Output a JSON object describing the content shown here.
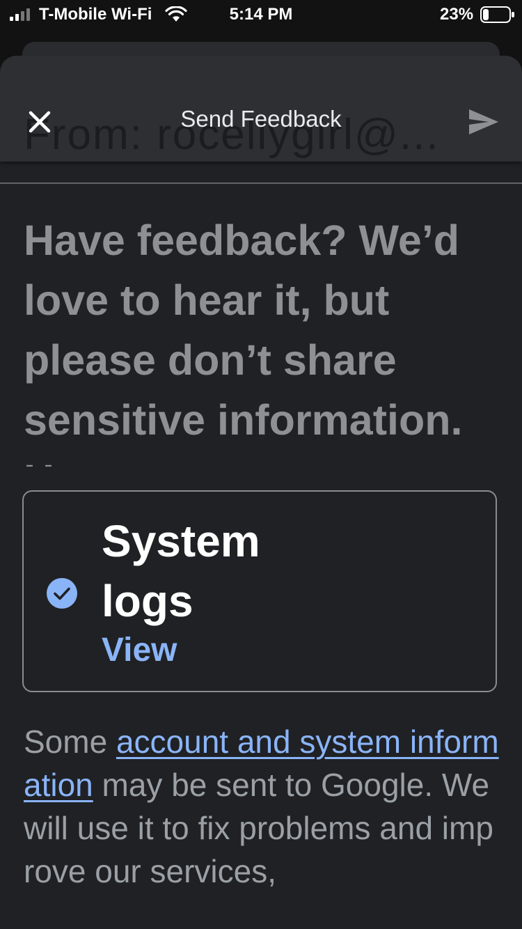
{
  "status_bar": {
    "carrier": "T-Mobile Wi-Fi",
    "time": "5:14 PM",
    "battery": "23%",
    "battery_level": 0.23
  },
  "toolbar": {
    "title": "Send Feedback",
    "from_ghost": "From:  rocellygirl@...",
    "close_icon": "close-icon",
    "send_icon": "send-icon"
  },
  "feedback": {
    "placeholder": "Have feedback? We’d love to hear it, but please don’t share sensitive information. Have"
  },
  "system_logs": {
    "label": "System logs",
    "checked": true,
    "view_label": "View"
  },
  "info": {
    "prefix": "Some ",
    "link": "account and system information",
    "suffix": " may be sent to Google. We will use it to fix problems and improve our services,"
  },
  "colors": {
    "accent": "#8ab4f8",
    "sheet_bg": "#202124",
    "toolbar_bg": "#2e2f32"
  }
}
